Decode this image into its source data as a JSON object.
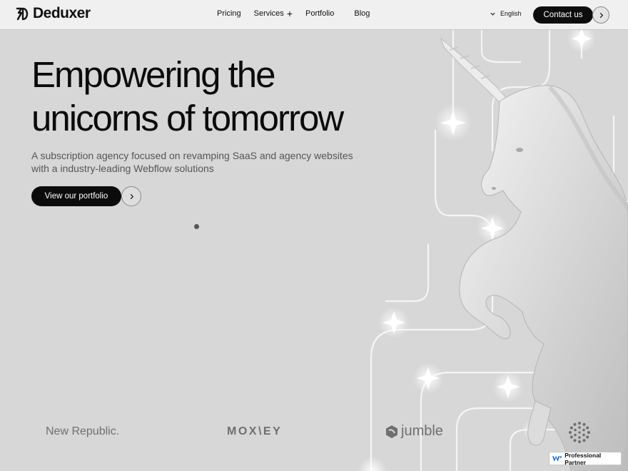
{
  "nav": {
    "brand": "Deduxer",
    "links": [
      "Pricing",
      "Services",
      "Portfolio",
      "Blog"
    ],
    "services_plus": "+",
    "language": "English",
    "contact_label": "Contact us"
  },
  "hero": {
    "title_line1": "Empowering the",
    "title_line2": "unicorns of tomorrow",
    "subtitle_line1": "A subscription agency focused on revamping SaaS and agency websites",
    "subtitle_line2": "with a industry-leading Webflow solutions",
    "cta_label": "View our portfolio"
  },
  "clients": {
    "new_republic": "New Republic.",
    "moxey": "MOX\\EY",
    "jumble": "jumble"
  },
  "badge": {
    "label": "Professional Partner"
  },
  "icons": {
    "lang": "chevron-down-icon",
    "contact_arrow": "chevron-right-icon",
    "cta_arrow": "chevron-right-icon",
    "webflow": "webflow-w-icon"
  }
}
